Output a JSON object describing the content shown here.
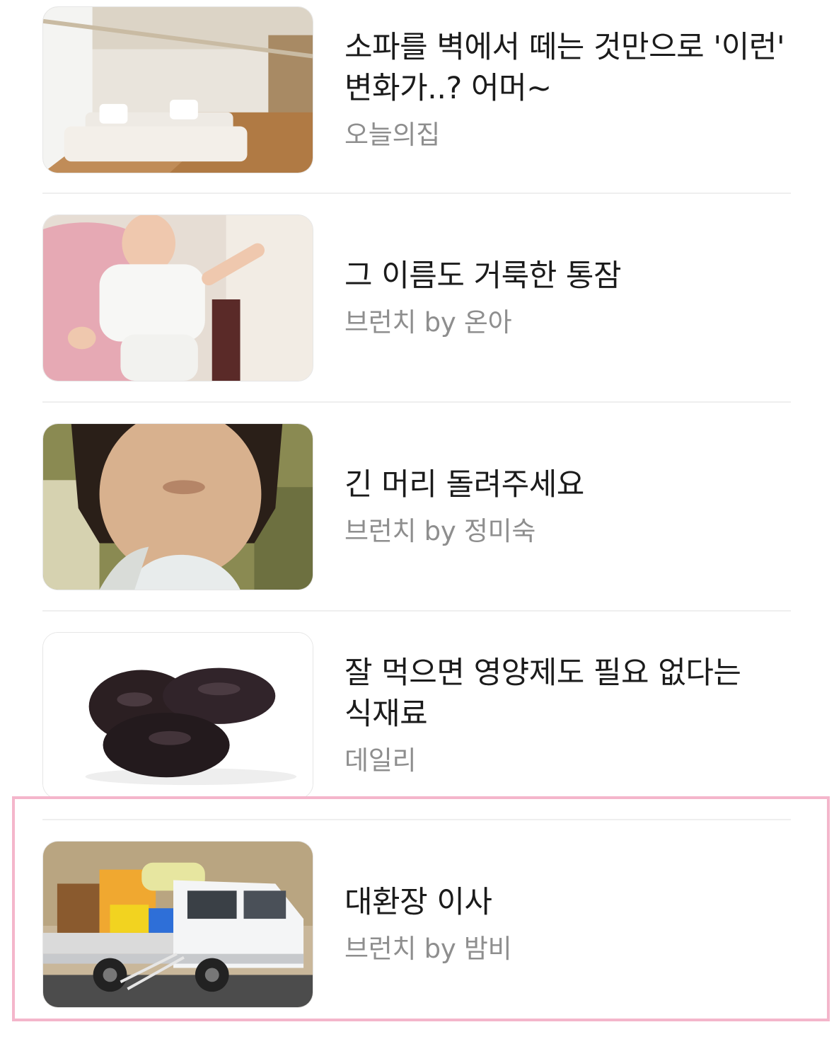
{
  "feed": {
    "items": [
      {
        "title": "소파를 벽에서 떼는 것만으로 '이런' 변화가..? 어머~",
        "source": "오늘의집",
        "thumbnail": "living-room-sofa-photo"
      },
      {
        "title": "그 이름도 거룩한 통잠",
        "source": "브런치 by 온아",
        "thumbnail": "sleeping-baby-photo"
      },
      {
        "title": "긴 머리 돌려주세요",
        "source": "브런치 by 정미숙",
        "thumbnail": "child-portrait-photo"
      },
      {
        "title": "잘 먹으면 영양제도 필요 없다는 식재료",
        "source": "데일리",
        "thumbnail": "dried-prunes-photo"
      },
      {
        "title": "대환장 이사",
        "source": "브런치 by 밤비",
        "thumbnail": "moving-truck-photo"
      }
    ],
    "highlighted_index": 4
  },
  "colors": {
    "title_text": "#1b1b1b",
    "source_text": "#8e8e8e",
    "divider": "#efefef",
    "highlight_border": "#f4b6cb",
    "background": "#ffffff"
  }
}
